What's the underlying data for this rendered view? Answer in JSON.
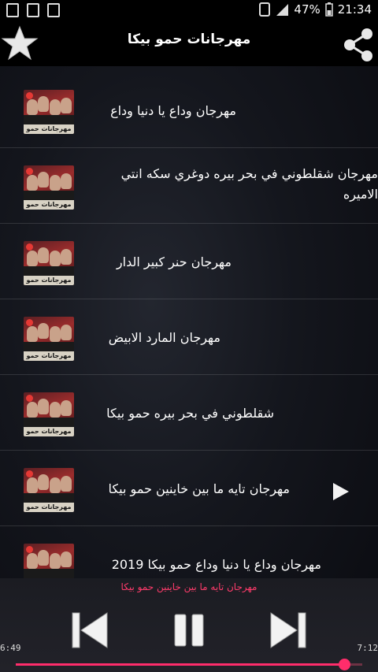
{
  "status_bar": {
    "battery": "47%",
    "time": "21:34"
  },
  "app_bar": {
    "title": "مهرجانات حمو بيكا",
    "star_icon": "star-icon",
    "share_icon": "share-icon"
  },
  "thumbnail_caption": "مهرجانات حمو بيكا",
  "tracks": [
    {
      "title": "مهرجان وداع يا دنيا وداع"
    },
    {
      "title": "مهرجان شقلطوني في بحر بيره دوغري سكه انتي الاميره"
    },
    {
      "title": "مهرجان حنر كبير الدار"
    },
    {
      "title": "مهرجان المارد الابيض"
    },
    {
      "title": "شقلطوني في بحر بيره حمو بيكا"
    },
    {
      "title": "مهرجان تايه ما بين خاينين حمو بيكا",
      "playing": true
    },
    {
      "title": "مهرجان وداع يا دنيا وداع حمو بيكا 2019"
    }
  ],
  "player": {
    "now_playing": "مهرجان تايه ما بين خاينين حمو بيكا",
    "elapsed": "6:49",
    "duration": "7:12",
    "progress": 0.948,
    "accent_color": "#ff2d6b",
    "prev_icon": "skip-previous-icon",
    "pause_icon": "pause-icon",
    "next_icon": "skip-next-icon"
  }
}
